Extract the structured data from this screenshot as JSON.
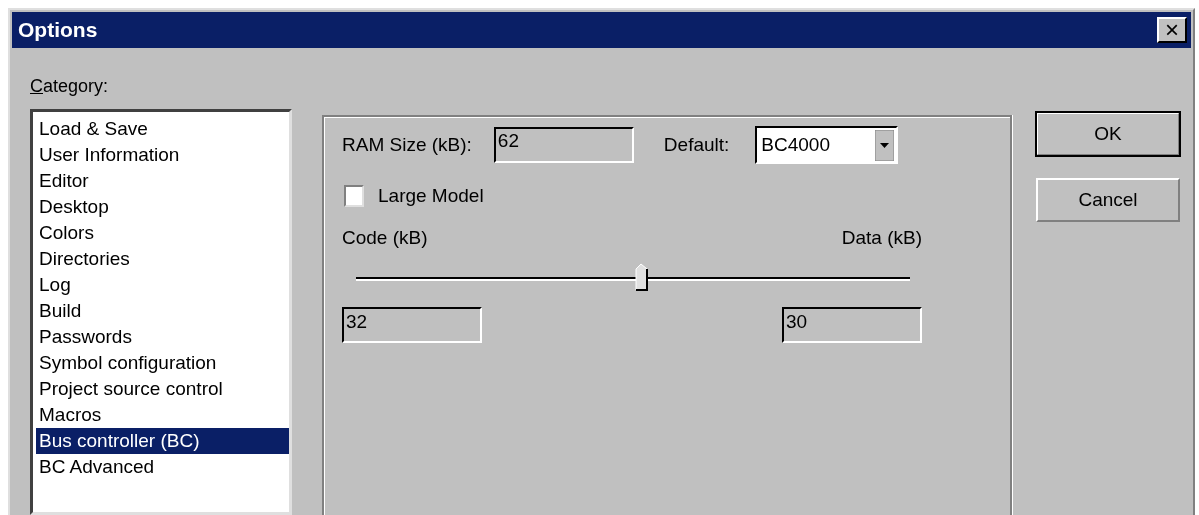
{
  "window": {
    "title": "Options",
    "close": "×"
  },
  "category": {
    "label": "Category:",
    "items": [
      {
        "label": "Load & Save",
        "selected": false
      },
      {
        "label": "User Information",
        "selected": false
      },
      {
        "label": "Editor",
        "selected": false
      },
      {
        "label": "Desktop",
        "selected": false
      },
      {
        "label": "Colors",
        "selected": false
      },
      {
        "label": "Directories",
        "selected": false
      },
      {
        "label": "Log",
        "selected": false
      },
      {
        "label": "Build",
        "selected": false
      },
      {
        "label": "Passwords",
        "selected": false
      },
      {
        "label": "Symbol configuration",
        "selected": false
      },
      {
        "label": "Project source control",
        "selected": false
      },
      {
        "label": "Macros",
        "selected": false
      },
      {
        "label": "Bus controller (BC)",
        "selected": true
      },
      {
        "label": "BC Advanced",
        "selected": false
      }
    ]
  },
  "panel": {
    "ram_size": {
      "label": "RAM Size (kB):",
      "value": "62"
    },
    "default": {
      "label": "Default:",
      "value": "BC4000"
    },
    "large_model": {
      "label": "Large Model",
      "checked": false
    },
    "code_label": "Code (kB)",
    "data_label": "Data (kB)",
    "split_slider": {
      "level": 0.516
    },
    "code_value": "32",
    "data_value": "30"
  },
  "buttons": [
    {
      "label": "OK",
      "default": true
    },
    {
      "label": "Cancel",
      "default": false
    }
  ]
}
